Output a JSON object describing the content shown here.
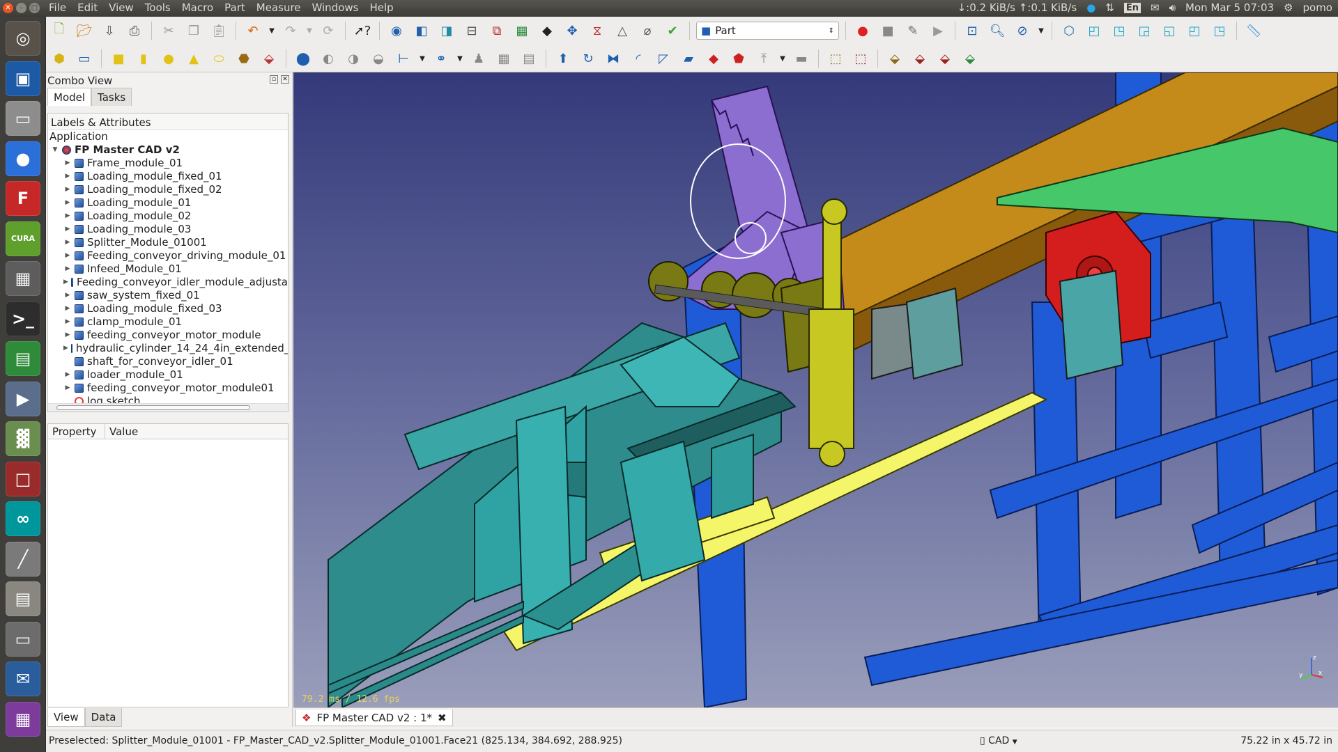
{
  "system": {
    "menus": [
      "File",
      "Edit",
      "View",
      "Tools",
      "Macro",
      "Part",
      "Measure",
      "Windows",
      "Help"
    ],
    "net": "↓:0.2 KiB/s ↑:0.1 KiB/s",
    "keyboard": "En",
    "clock": "Mon Mar  5 07:03",
    "user": "pomo"
  },
  "launcher": {
    "items": [
      {
        "name": "ubuntu-dash",
        "icon": "ubuntu-icon",
        "bg": "#58524a",
        "glyph": "◎"
      },
      {
        "name": "image-viewer",
        "icon": "image-icon",
        "bg": "#1c5aa6",
        "glyph": "▣"
      },
      {
        "name": "disk",
        "icon": "disk-icon",
        "bg": "#8d8d8d",
        "glyph": "▭"
      },
      {
        "name": "chromium",
        "icon": "chromium-icon",
        "bg": "#2b6fd8",
        "glyph": "●"
      },
      {
        "name": "freecad",
        "icon": "freecad-icon",
        "bg": "#c62828",
        "glyph": "F"
      },
      {
        "name": "cura",
        "icon": "cura-icon",
        "bg": "#5f9f2c",
        "glyph": "CURA"
      },
      {
        "name": "calculator",
        "icon": "calculator-icon",
        "bg": "#5d5d5d",
        "glyph": "▦"
      },
      {
        "name": "terminal",
        "icon": "terminal-icon",
        "bg": "#2d2d2d",
        "glyph": ">_"
      },
      {
        "name": "spreadsheet",
        "icon": "spreadsheet-icon",
        "bg": "#2e8b3a",
        "glyph": "▤"
      },
      {
        "name": "media",
        "icon": "media-icon",
        "bg": "#5a6e8c",
        "glyph": "▶"
      },
      {
        "name": "system-monitor",
        "icon": "monitor-icon",
        "bg": "#6a8e4e",
        "glyph": "▓"
      },
      {
        "name": "app-red",
        "icon": "app-icon",
        "bg": "#9a2b2b",
        "glyph": "□"
      },
      {
        "name": "arduino",
        "icon": "arduino-icon",
        "bg": "#00979c",
        "glyph": "∞"
      },
      {
        "name": "slicer",
        "icon": "slicer-icon",
        "bg": "#7a7a7a",
        "glyph": "╱"
      },
      {
        "name": "files",
        "icon": "files-icon",
        "bg": "#8a8780",
        "glyph": "▤"
      },
      {
        "name": "scanner",
        "icon": "scanner-icon",
        "bg": "#6c6c6c",
        "glyph": "▭"
      },
      {
        "name": "thunderbird",
        "icon": "thunderbird-icon",
        "bg": "#2a5d9b",
        "glyph": "✉"
      },
      {
        "name": "workspace",
        "icon": "workspace-icon",
        "bg": "#7d3b9b",
        "glyph": "▦"
      }
    ]
  },
  "toolbar": {
    "workbench": "Part"
  },
  "combo": {
    "title": "Combo View",
    "tabs": [
      "Model",
      "Tasks"
    ],
    "tree_header": "Labels & Attributes",
    "tree_section": "Application",
    "root": "FP Master CAD v2",
    "items": [
      {
        "label": "Frame_module_01",
        "expand": true
      },
      {
        "label": "Loading_module_fixed_01",
        "expand": true
      },
      {
        "label": "Loading_module_fixed_02",
        "expand": true
      },
      {
        "label": "Loading_module_01",
        "expand": true
      },
      {
        "label": "Loading_module_02",
        "expand": true
      },
      {
        "label": "Loading_module_03",
        "expand": true
      },
      {
        "label": "Splitter_Module_01001",
        "expand": true
      },
      {
        "label": "Feeding_conveyor_driving_module_01",
        "expand": true
      },
      {
        "label": "Infeed_Module_01",
        "expand": true
      },
      {
        "label": "Feeding_conveyor_idler_module_adjusta",
        "expand": true
      },
      {
        "label": "saw_system_fixed_01",
        "expand": true
      },
      {
        "label": "Loading_module_fixed_03",
        "expand": true
      },
      {
        "label": "clamp_module_01",
        "expand": true
      },
      {
        "label": "feeding_conveyor_motor_module",
        "expand": true
      },
      {
        "label": "hydraulic_cylinder_14_24_4in_extended_",
        "expand": true
      },
      {
        "label": "shaft_for_conveyor_idler_01",
        "expand": false
      },
      {
        "label": "loader_module_01",
        "expand": true
      },
      {
        "label": "feeding_conveyor_motor_module01",
        "expand": true
      },
      {
        "label": "log sketch",
        "expand": false,
        "sketch": true
      }
    ],
    "prop_headers": [
      "Property",
      "Value"
    ],
    "bottom_tabs": [
      "View",
      "Data"
    ]
  },
  "viewport": {
    "fps": "79.2 ms / 12.6 fps",
    "axes": {
      "x": "x",
      "y": "y",
      "z": "z"
    }
  },
  "document_tab": "FP Master CAD v2 : 1*",
  "status": {
    "message": "Preselected: Splitter_Module_01001 - FP_Master_CAD_v2.Splitter_Module_01001.Face21 (825.134, 384.692, 288.925)",
    "nav_style": "CAD",
    "dimensions": "75.22 in x 45.72 in"
  }
}
